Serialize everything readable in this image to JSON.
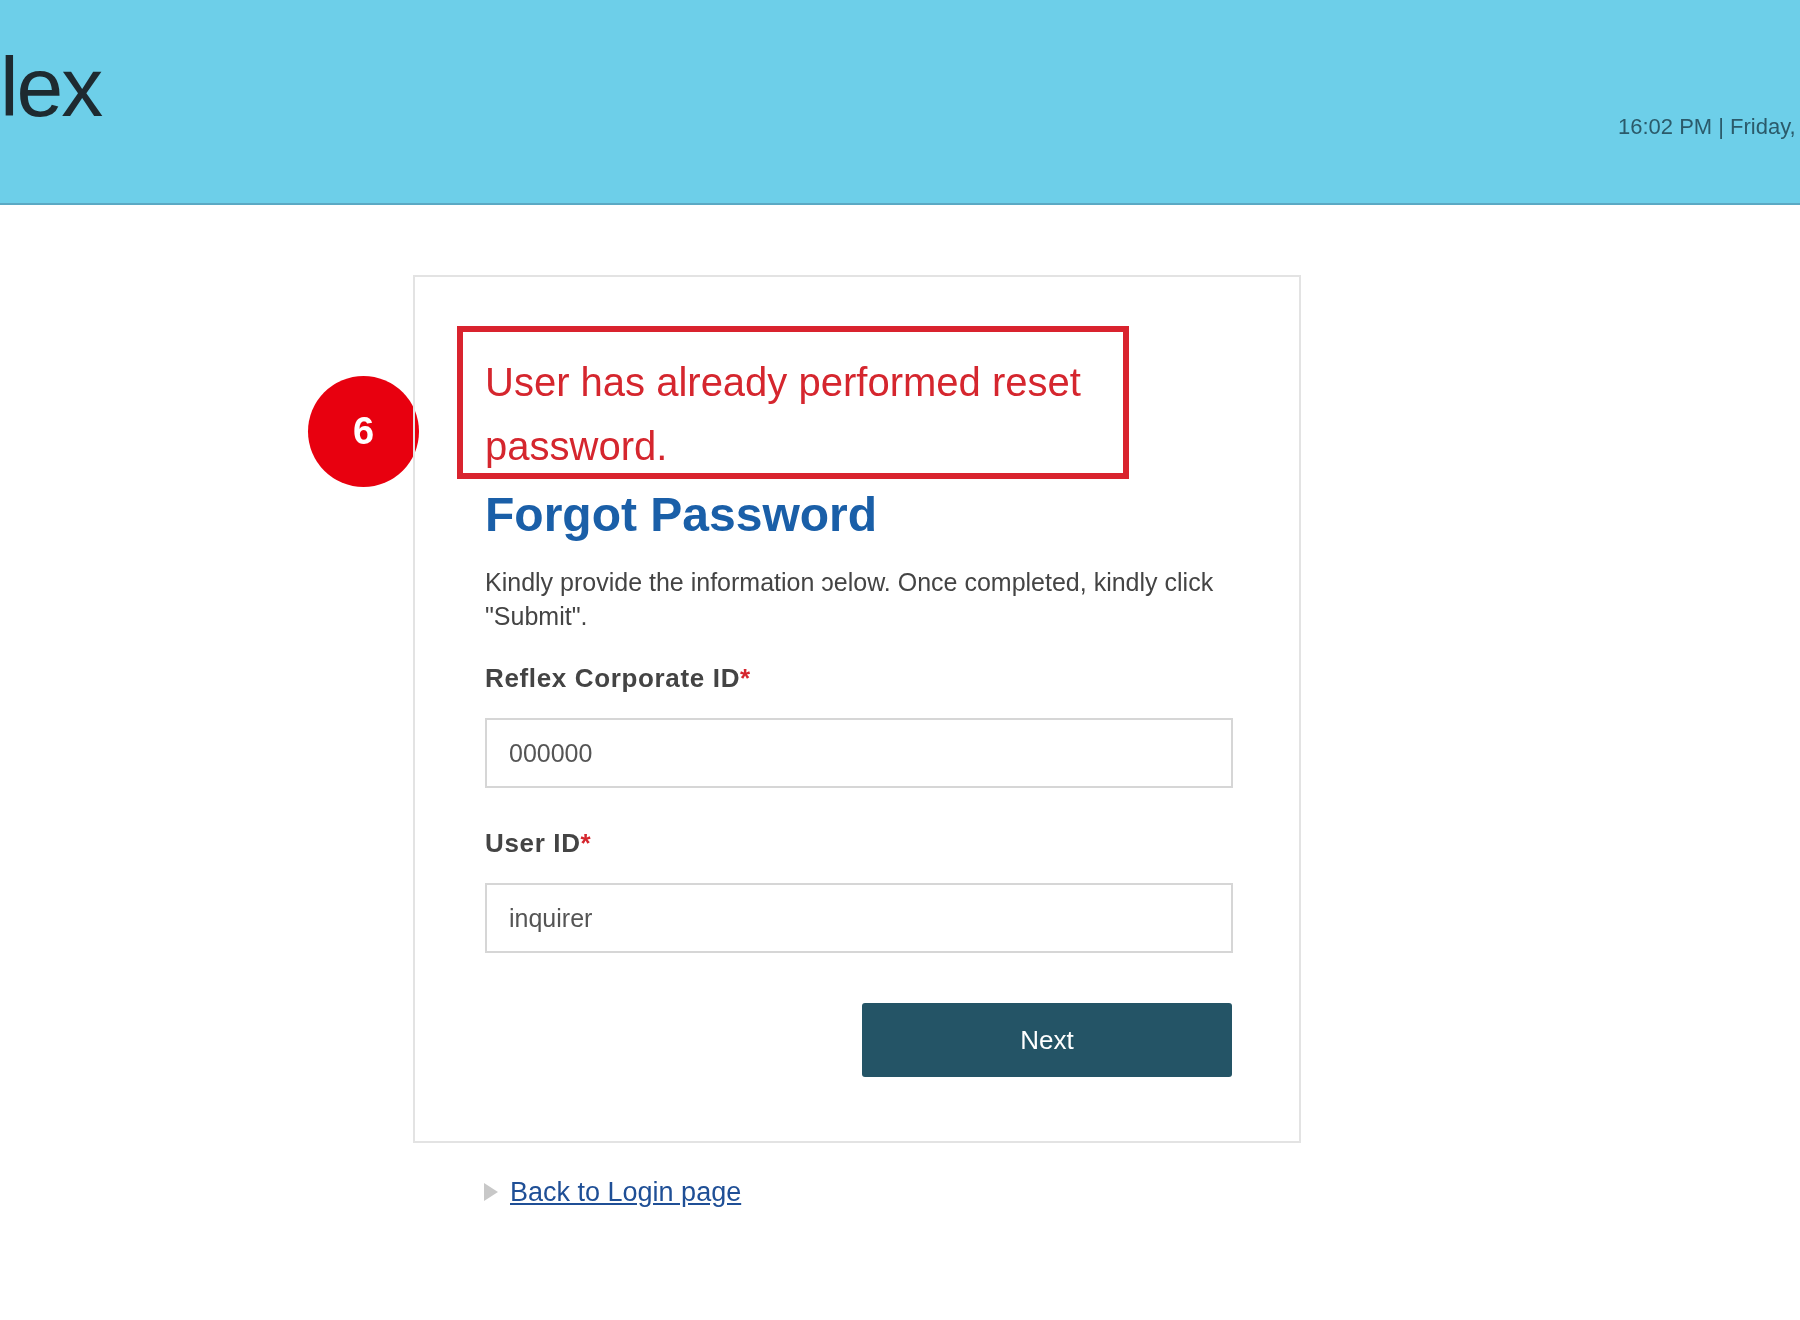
{
  "header": {
    "logo": "lex",
    "datetime": "16:02 PM | Friday,"
  },
  "annotation": {
    "number": "6"
  },
  "error_message": "User has already performed reset password.",
  "form": {
    "title": "Forgot Password",
    "instructions": "Kindly provide the information ɔelow. Once completed, kindly click \"Submit\".",
    "fields": [
      {
        "label": "Reflex Corporate ID",
        "required_mark": "*",
        "value": "000000"
      },
      {
        "label": "User ID",
        "required_mark": "*",
        "value": "inquirer"
      }
    ],
    "button": "Next"
  },
  "back_link": "Back to Login page"
}
